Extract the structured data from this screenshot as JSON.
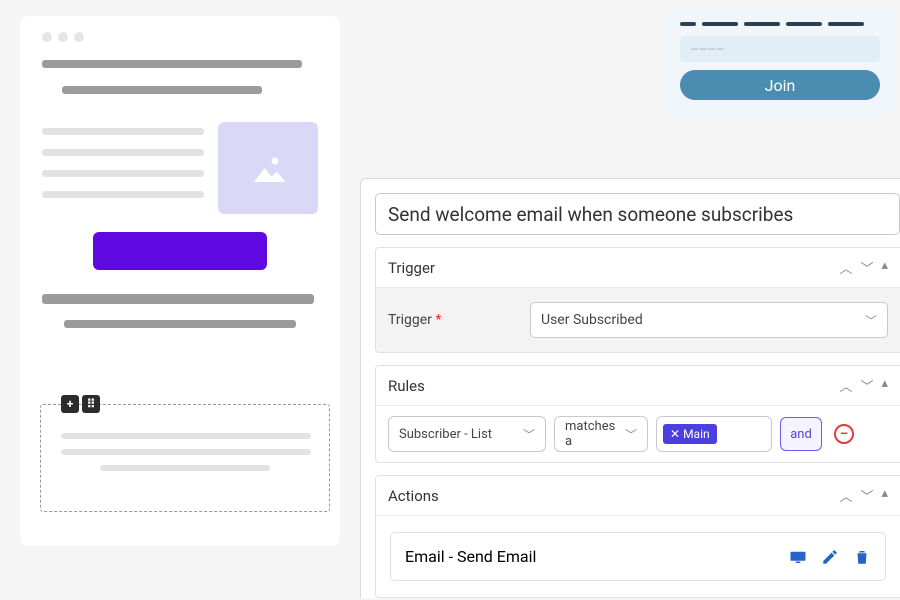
{
  "join": {
    "placeholder": "————",
    "button": "Join"
  },
  "automation": {
    "title": "Send welcome email when someone subscribes",
    "sections": {
      "trigger": {
        "heading": "Trigger",
        "field_label": "Trigger",
        "value": "User Subscribed"
      },
      "rules": {
        "heading": "Rules",
        "field": "Subscriber - List",
        "operator": "matches a",
        "tag": "Main",
        "conjunction": "and"
      },
      "actions": {
        "heading": "Actions",
        "item": "Email - Send Email"
      }
    }
  }
}
